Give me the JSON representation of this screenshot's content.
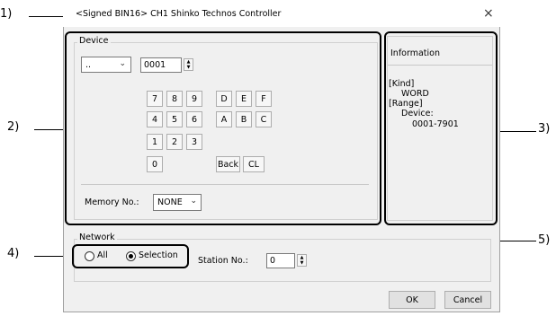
{
  "dialog": {
    "title": "<Signed BIN16> CH1 Shinko Technos Controller",
    "close_glyph": "×"
  },
  "device": {
    "group_label": "Device",
    "type_value": "..",
    "address_value": "0001",
    "keypad": [
      "7",
      "8",
      "9",
      "4",
      "5",
      "6",
      "1",
      "2",
      "3",
      "0"
    ],
    "hex_keys": [
      "D",
      "E",
      "F",
      "A",
      "B",
      "C"
    ],
    "back_label": "Back",
    "clear_label": "CL",
    "memory_label": "Memory No.:",
    "memory_value": "NONE"
  },
  "information": {
    "title": "Information",
    "kind_label": "[Kind]",
    "kind_value": "WORD",
    "range_label": "[Range]",
    "device_label": "Device:",
    "device_range": "0001-7901"
  },
  "network": {
    "group_label": "Network",
    "option_all": "All",
    "option_selection": "Selection",
    "selected": "Selection",
    "station_label": "Station No.:",
    "station_value": "0"
  },
  "buttons": {
    "ok": "OK",
    "cancel": "Cancel"
  },
  "callouts": [
    "1)",
    "2)",
    "3)",
    "4)",
    "5)"
  ]
}
